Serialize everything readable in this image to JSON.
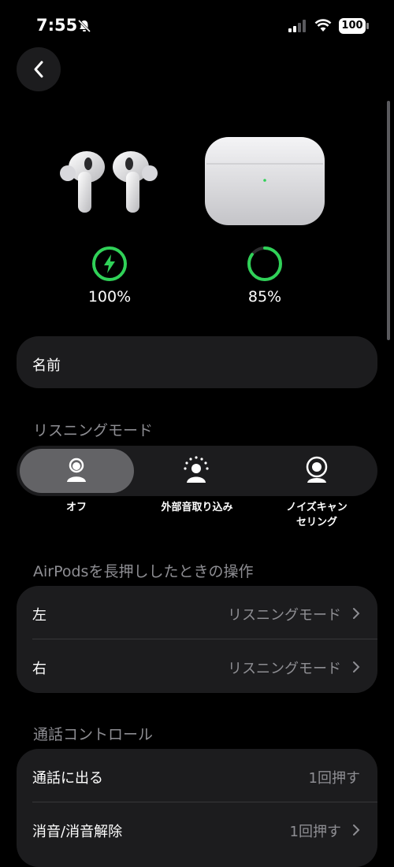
{
  "status_bar": {
    "time": "7:55",
    "battery": "100"
  },
  "devices": {
    "buds_battery": "100%",
    "case_battery": "85%",
    "buds_level": 1.0,
    "case_level": 0.85
  },
  "name_row": {
    "label": "名前"
  },
  "listening": {
    "title": "リスニングモード",
    "modes": [
      "オフ",
      "外部音取り込み",
      "ノイズキャン\nセリング"
    ],
    "selected": "オフ"
  },
  "press_hold": {
    "title": "AirPodsを長押ししたときの操作",
    "rows": [
      {
        "label": "左",
        "value": "リスニングモード"
      },
      {
        "label": "右",
        "value": "リスニングモード"
      }
    ]
  },
  "call_controls": {
    "title": "通話コントロール",
    "rows": [
      {
        "label": "通話に出る",
        "value": "1回押す"
      },
      {
        "label": "消音/消音解除",
        "value": "1回押す"
      }
    ]
  },
  "colors": {
    "background": "#000000",
    "card": "#1c1c1e",
    "accent_green": "#30d158",
    "secondary_text": "#8e8e93"
  }
}
